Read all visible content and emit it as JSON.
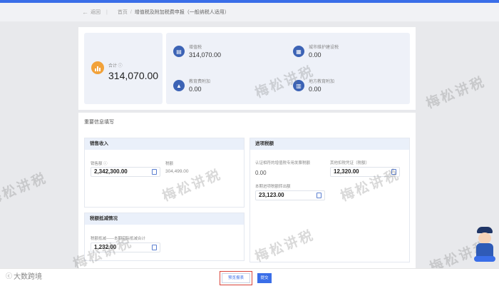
{
  "nav": {
    "back": "返回",
    "home": "首页",
    "current": "增值税及附加税费申报（一般纳税人适用）"
  },
  "summary": {
    "total_label": "合计 ⓘ",
    "total_value": "314,070.00",
    "items": [
      {
        "label": "增值税",
        "value": "314,070.00"
      },
      {
        "label": "城市维护建设税",
        "value": "0.00"
      },
      {
        "label": "教育费附加",
        "value": "0.00"
      },
      {
        "label": "地方教育附加",
        "value": "0.00"
      }
    ]
  },
  "detail": {
    "title": "重要信息填写",
    "sales": {
      "title": "销售收入",
      "amount_label": "销售额 ⓘ",
      "amount_value": "2,342,300.00",
      "tax_label": "税额",
      "tax_value": "304,499.00"
    },
    "input_tax": {
      "title": "进项税额",
      "certified_label": "认证相符的增值税专用发票税额",
      "certified_value": "0.00",
      "other_label": "其他扣税凭证（税额）",
      "other_value": "12,320.00",
      "current_label": "本期进项税额转出额",
      "current_value": "23,123.00"
    },
    "reduction": {
      "title": "税额抵减情况",
      "label": "税额抵减——本期实际抵减合计",
      "value": "1,232.00"
    }
  },
  "footer": {
    "preview": "预览报表",
    "submit": "提交"
  },
  "logo": {
    "mark": "ⓒ",
    "text": "大数跨境"
  },
  "watermark": "梅松讲税",
  "colors": {
    "accent": "#3a6ee8",
    "highlight": "#d9443a",
    "total_icon": "#f2a23a"
  }
}
